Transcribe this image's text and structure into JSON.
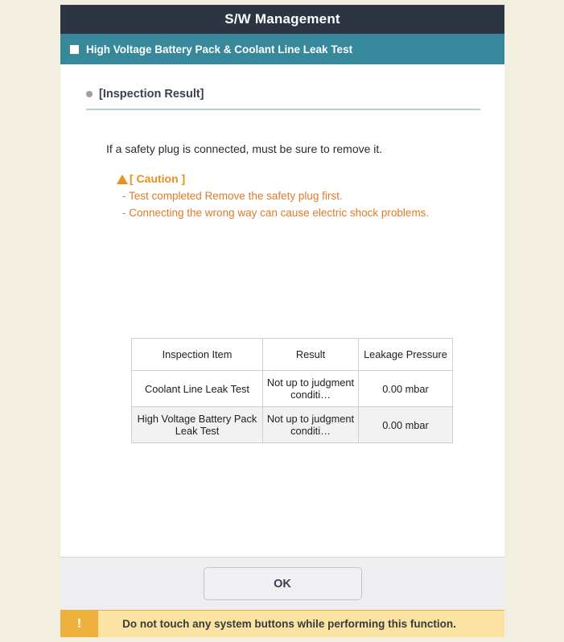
{
  "window": {
    "title": "S/W Management"
  },
  "sub_header": {
    "bullet_icon": "square-bullet-icon",
    "label": "High Voltage Battery Pack & Coolant Line Leak Test"
  },
  "section": {
    "bullet_icon": "dot-bullet-icon",
    "title": "[Inspection Result]"
  },
  "body": {
    "intro": "If a safety plug is connected, must be sure to remove it."
  },
  "caution": {
    "icon": "warning-triangle-icon",
    "title": "[ Caution ]",
    "lines": [
      "- Test completed Remove the safety plug first.",
      "- Connecting the wrong way can cause electric shock problems."
    ]
  },
  "table": {
    "headers": [
      "Inspection Item",
      "Result",
      "Leakage Pressure"
    ],
    "rows": [
      {
        "item": "Coolant Line Leak Test",
        "result": "Not up to judgment conditi…",
        "pressure": "0.00 mbar"
      },
      {
        "item": "High Voltage Battery Pack Leak Test",
        "result": "Not up to judgment conditi…",
        "pressure": "0.00 mbar"
      }
    ]
  },
  "actions": {
    "ok_label": "OK"
  },
  "notice": {
    "icon": "exclamation-icon",
    "icon_glyph": "!",
    "text": "Do not touch any system buttons while performing this function."
  },
  "colors": {
    "title_bar": "#2d3442",
    "sub_header": "#36889a",
    "caution": "#e07b28",
    "result_red": "#e02020",
    "notice_bg": "#fae3a3",
    "notice_icon_bg": "#efb13d",
    "page_bg": "#f3efe0"
  }
}
